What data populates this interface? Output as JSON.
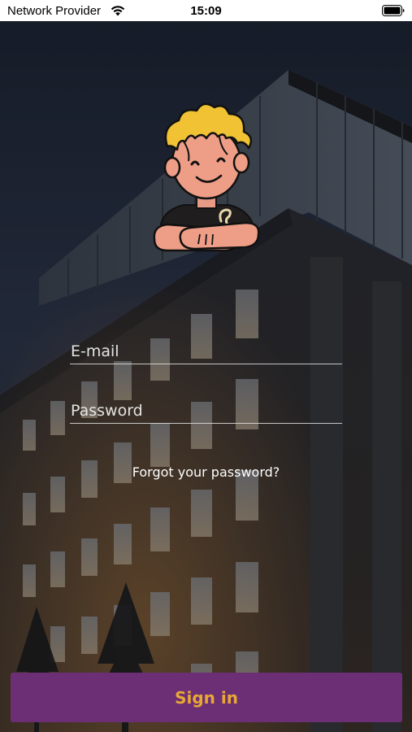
{
  "status_bar": {
    "carrier": "Network Provider",
    "time": "15:09",
    "wifi_icon": "wifi-icon",
    "battery_icon": "battery-icon"
  },
  "login": {
    "email_placeholder": "E-mail",
    "password_placeholder": "Password",
    "forgot_label": "Forgot your password?",
    "signin_label": "Sign in"
  },
  "colors": {
    "button_bg": "#6c2f75",
    "button_text": "#e8a834",
    "status_bar_bg": "#ffffff"
  }
}
